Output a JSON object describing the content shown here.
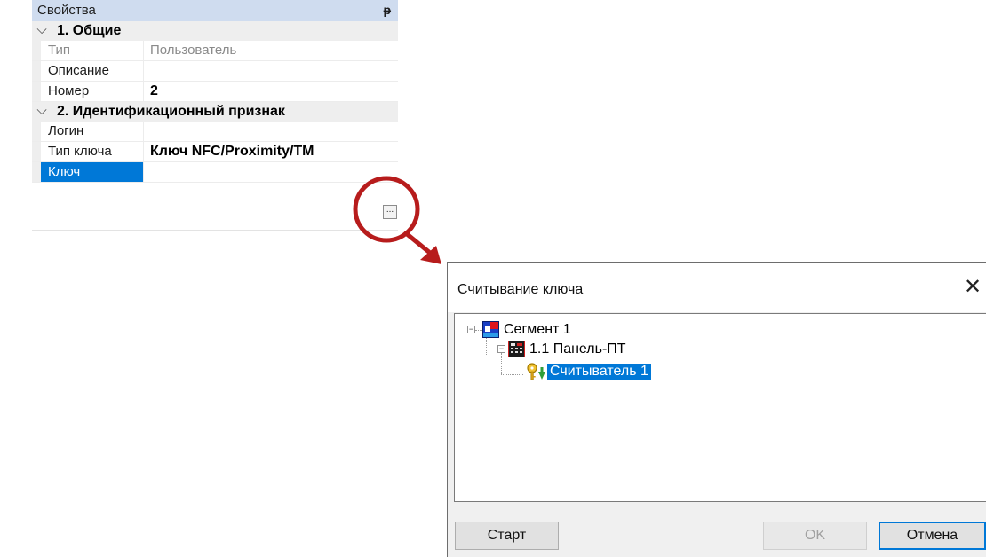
{
  "properties_panel": {
    "title": "Свойства",
    "pin_glyph": "ᵽ",
    "categories": [
      {
        "label": "1. Общие",
        "expanded": true,
        "rows": [
          {
            "name": "Тип",
            "value": "Пользователь",
            "readonly": true
          },
          {
            "name": "Описание",
            "value": ""
          },
          {
            "name": "Номер",
            "value": "2"
          }
        ]
      },
      {
        "label": "2. Идентификационный признак",
        "expanded": true,
        "rows": [
          {
            "name": "Логин",
            "value": ""
          },
          {
            "name": "Тип ключа",
            "value": "Ключ NFC/Proximity/TM"
          },
          {
            "name": "Ключ",
            "value": "",
            "selected": true,
            "editor_button": "..."
          }
        ]
      }
    ]
  },
  "dialog": {
    "title": "Считывание ключа",
    "close_glyph": "✕",
    "tree": [
      {
        "label": "Сегмент 1",
        "icon": "segment-icon",
        "expanded": true
      },
      {
        "label": "1.1 Панель-ПТ",
        "icon": "panel-device-icon",
        "expanded": true
      },
      {
        "label": "Считыватель 1",
        "icon": "key-reader-icon",
        "selected": true
      }
    ],
    "buttons": {
      "start": "Старт",
      "ok": "OK",
      "cancel": "Отмена"
    }
  },
  "colors": {
    "selection": "#0078d7",
    "callout": "#b71c1c",
    "header": "#cfdcef"
  }
}
